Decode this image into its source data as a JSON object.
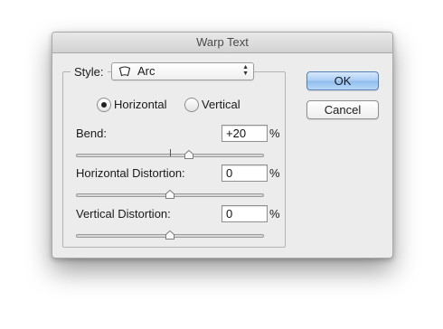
{
  "dialog": {
    "title": "Warp Text"
  },
  "style": {
    "label": "Style:",
    "selected_value": "Arc",
    "shape_icon": "arc-warp-shape-icon",
    "arrows_up": "▲",
    "arrows_down": "▼"
  },
  "orientation": {
    "horizontal_label": "Horizontal",
    "vertical_label": "Vertical",
    "selected": "Horizontal"
  },
  "bend": {
    "label": "Bend:",
    "value": "+20",
    "unit": "%",
    "slider_level": 0.6
  },
  "horizontal_distortion": {
    "label": "Horizontal Distortion:",
    "value": "0",
    "unit": "%",
    "slider_level": 0.5
  },
  "vertical_distortion": {
    "label": "Vertical Distortion:",
    "value": "0",
    "unit": "%",
    "slider_level": 0.5
  },
  "buttons": {
    "ok": "OK",
    "cancel": "Cancel"
  }
}
